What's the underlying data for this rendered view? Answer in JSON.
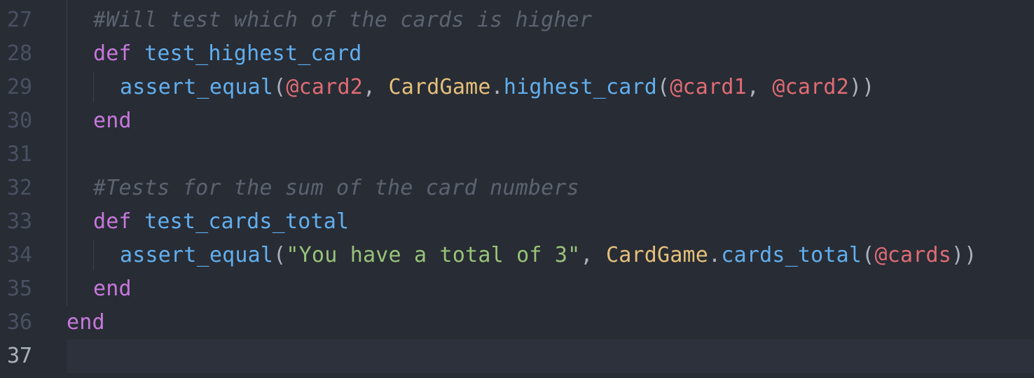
{
  "editor": {
    "lines": [
      {
        "num": "27",
        "comment": "#Will test which of the cards is higher"
      },
      {
        "num": "28",
        "kw": "def",
        "fn": "test_highest_card"
      },
      {
        "num": "29",
        "fn": "assert_equal",
        "p1": "(",
        "ivar1": "@card2",
        "p2": ", ",
        "cls": "CardGame",
        "p3": ".",
        "fn2": "highest_card",
        "p4": "(",
        "ivar2": "@card1",
        "p5": ", ",
        "ivar3": "@card2",
        "p6": "))"
      },
      {
        "num": "30",
        "kw": "end"
      },
      {
        "num": "31"
      },
      {
        "num": "32",
        "comment": "#Tests for the sum of the card numbers"
      },
      {
        "num": "33",
        "kw": "def",
        "fn": "test_cards_total"
      },
      {
        "num": "34",
        "fn": "assert_equal",
        "p1": "(",
        "str": "\"You have a total of 3\"",
        "p2": ", ",
        "cls": "CardGame",
        "p3": ".",
        "fn2": "cards_total",
        "p4": "(",
        "ivar1": "@cards",
        "p5": "))"
      },
      {
        "num": "35",
        "kw": "end"
      },
      {
        "num": "36",
        "kw": "end"
      },
      {
        "num": "37"
      }
    ]
  }
}
